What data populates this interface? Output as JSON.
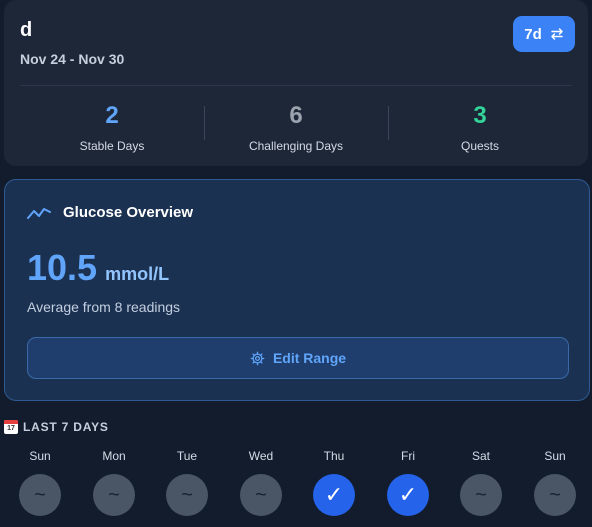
{
  "header": {
    "user_name": "d",
    "date_range": "Nov 24 - Nov 30",
    "range_button_label": "7d",
    "range_button_icon": "swap-arrows-icon"
  },
  "stats": [
    {
      "value": "2",
      "label": "Stable Days",
      "color": "#60a5fa"
    },
    {
      "value": "6",
      "label": "Challenging Days",
      "color": "#9ca3af"
    },
    {
      "value": "3",
      "label": "Quests",
      "color": "#34d399"
    }
  ],
  "glucose": {
    "title": "Glucose Overview",
    "icon": "trend-line-icon",
    "value": "10.5",
    "unit": "mmol/L",
    "caption": "Average from 8 readings",
    "edit_button_label": "Edit Range",
    "edit_button_icon": "gear-icon"
  },
  "week": {
    "heading": "LAST 7 DAYS",
    "heading_icon": "calendar-icon",
    "days": [
      {
        "label": "Sun",
        "symbol": "~",
        "status": "neutral"
      },
      {
        "label": "Mon",
        "symbol": "~",
        "status": "neutral"
      },
      {
        "label": "Tue",
        "symbol": "~",
        "status": "neutral"
      },
      {
        "label": "Wed",
        "symbol": "~",
        "status": "neutral"
      },
      {
        "label": "Thu",
        "symbol": "✓",
        "status": "done"
      },
      {
        "label": "Fri",
        "symbol": "✓",
        "status": "done"
      },
      {
        "label": "Sat",
        "symbol": "~",
        "status": "neutral"
      },
      {
        "label": "Sun",
        "symbol": "~",
        "status": "neutral"
      }
    ]
  },
  "colors": {
    "accent": "#3b82f6",
    "background": "#121c2d",
    "card": "#1d2738",
    "glucose_card": "#1b3152"
  }
}
